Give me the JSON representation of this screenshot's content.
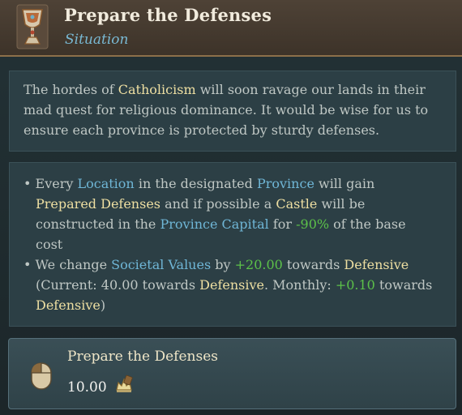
{
  "header": {
    "title": "Prepare the Defenses",
    "subtitle": "Situation",
    "icon": "chalice-icon"
  },
  "description": {
    "line1_a": "The hordes of ",
    "line1_kw": "Catholicism",
    "line1_b": " will soon ravage our lands in their",
    "line2": "mad quest for religious dominance. It would be wise for us to",
    "line3": "ensure each province is protected by sturdy defenses."
  },
  "effects": {
    "e1": {
      "bullet": "• Every ",
      "location": "Location",
      "t1": " in the designated ",
      "province": "Province",
      "t2": " will gain",
      "prepared": "Prepared Defenses",
      "t3": " and if possible a ",
      "castle": "Castle",
      "t4": " will be",
      "t5": "constructed in the ",
      "capital": "Province Capital",
      "t6": " for ",
      "pct": "-90%",
      "t7": " of the base",
      "t8": "cost"
    },
    "e2": {
      "bullet": "• We change ",
      "societal": "Societal Values",
      "t1": " by ",
      "amount": "+20.00",
      "t2": " towards ",
      "defensive1": "Defensive",
      "t3": "(Current: 40.00 towards ",
      "defensive2": "Defensive",
      "t4": ". Monthly: ",
      "monthly": "+0.10",
      "t5": " towards",
      "defensive3": "Defensive",
      "t6": ")"
    }
  },
  "action": {
    "title": "Prepare the Defenses",
    "cost": "10.00",
    "mouse_icon": "mouse-left-click-icon",
    "cost_icon": "crown-power-icon"
  },
  "colors": {
    "keyword": "#eedfa2",
    "link": "#6fb6d6",
    "positive": "#5cc149",
    "header_bg": "#4e4236"
  }
}
